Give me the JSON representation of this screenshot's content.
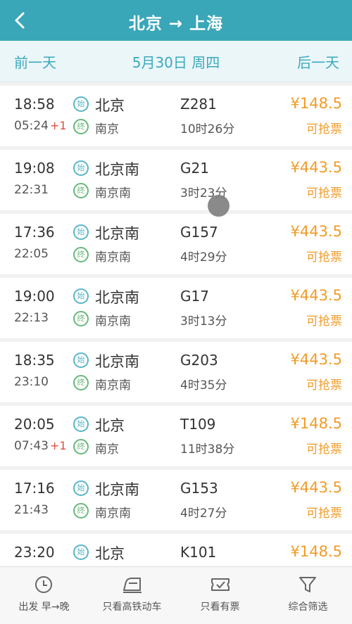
{
  "header": {
    "title": "北京 → 上海",
    "back_icon": "chevron-left-icon"
  },
  "date_bar": {
    "prev": "前一天",
    "current": "5月30日 周四",
    "next": "后一天"
  },
  "badges": {
    "start": "始",
    "end": "终"
  },
  "trains": [
    {
      "dep_time": "18:58",
      "arr_time": "05:24",
      "next_day": "+1",
      "from": "北京",
      "to": "南京",
      "code": "Z281",
      "duration": "10时26分",
      "price": "¥148.5",
      "status": "可抢票"
    },
    {
      "dep_time": "19:08",
      "arr_time": "22:31",
      "next_day": "",
      "from": "北京南",
      "to": "南京南",
      "code": "G21",
      "duration": "3时23分",
      "price": "¥443.5",
      "status": "可抢票"
    },
    {
      "dep_time": "17:36",
      "arr_time": "22:05",
      "next_day": "",
      "from": "北京南",
      "to": "南京南",
      "code": "G157",
      "duration": "4时29分",
      "price": "¥443.5",
      "status": "可抢票"
    },
    {
      "dep_time": "19:00",
      "arr_time": "22:13",
      "next_day": "",
      "from": "北京南",
      "to": "南京南",
      "code": "G17",
      "duration": "3时13分",
      "price": "¥443.5",
      "status": "可抢票"
    },
    {
      "dep_time": "18:35",
      "arr_time": "23:10",
      "next_day": "",
      "from": "北京南",
      "to": "南京南",
      "code": "G203",
      "duration": "4时35分",
      "price": "¥443.5",
      "status": "可抢票"
    },
    {
      "dep_time": "20:05",
      "arr_time": "07:43",
      "next_day": "+1",
      "from": "北京",
      "to": "南京",
      "code": "T109",
      "duration": "11时38分",
      "price": "¥148.5",
      "status": "可抢票"
    },
    {
      "dep_time": "17:16",
      "arr_time": "21:43",
      "next_day": "",
      "from": "北京南",
      "to": "南京南",
      "code": "G153",
      "duration": "4时27分",
      "price": "¥443.5",
      "status": "可抢票"
    },
    {
      "dep_time": "23:20",
      "arr_time": "",
      "next_day": "",
      "from": "北京",
      "to": "",
      "code": "K101",
      "duration": "",
      "price": "¥148.5",
      "status": ""
    }
  ],
  "bottom_tabs": [
    {
      "label": "出发 早→晚",
      "icon": "clock-icon"
    },
    {
      "label": "只看高铁动车",
      "icon": "train-icon"
    },
    {
      "label": "只看有票",
      "icon": "ticket-icon"
    },
    {
      "label": "综合筛选",
      "icon": "filter-icon"
    }
  ],
  "colors": {
    "header": "#3aa7b9",
    "accent": "#3ba9bc",
    "price": "#f39b26",
    "next_day": "#e24c3b"
  }
}
